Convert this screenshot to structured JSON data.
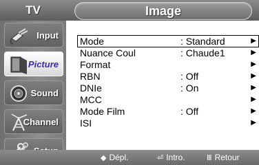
{
  "header": {
    "tv_label": "TV",
    "title": "Image"
  },
  "sidebar": {
    "items": [
      {
        "label": "Input",
        "icon": "plug-icon",
        "active": false
      },
      {
        "label": "Picture",
        "icon": "picture-icon",
        "active": true
      },
      {
        "label": "Sound",
        "icon": "speaker-icon",
        "active": false
      },
      {
        "label": "Channel",
        "icon": "antenna-icon",
        "active": false
      },
      {
        "label": "Setup",
        "icon": "tools-icon",
        "active": false
      }
    ]
  },
  "menu": {
    "rows": [
      {
        "label": "Mode",
        "value": ": Standard",
        "selected": true
      },
      {
        "label": "Nuance Coul",
        "value": ": Chaude1",
        "selected": false
      },
      {
        "label": "Format",
        "value": "",
        "selected": false
      },
      {
        "label": "RBN",
        "value": ": Off",
        "selected": false
      },
      {
        "label": "DNIe",
        "value": ": On",
        "selected": false
      },
      {
        "label": "MCC",
        "value": "",
        "selected": false
      },
      {
        "label": "Mode Film",
        "value": ": Off",
        "selected": false
      },
      {
        "label": "ISI",
        "value": "",
        "selected": false
      }
    ],
    "arrow": "▶"
  },
  "hints": {
    "move": {
      "icon": "◆",
      "label": "Dépl."
    },
    "enter": {
      "icon": "⏎",
      "label": "Intro."
    },
    "return": {
      "icon": "Ⅲ",
      "label": "Retour"
    }
  },
  "colors": {
    "bar": "#7a7a7a",
    "active_label": "#3a2aa6",
    "panel": "#ffffff"
  }
}
